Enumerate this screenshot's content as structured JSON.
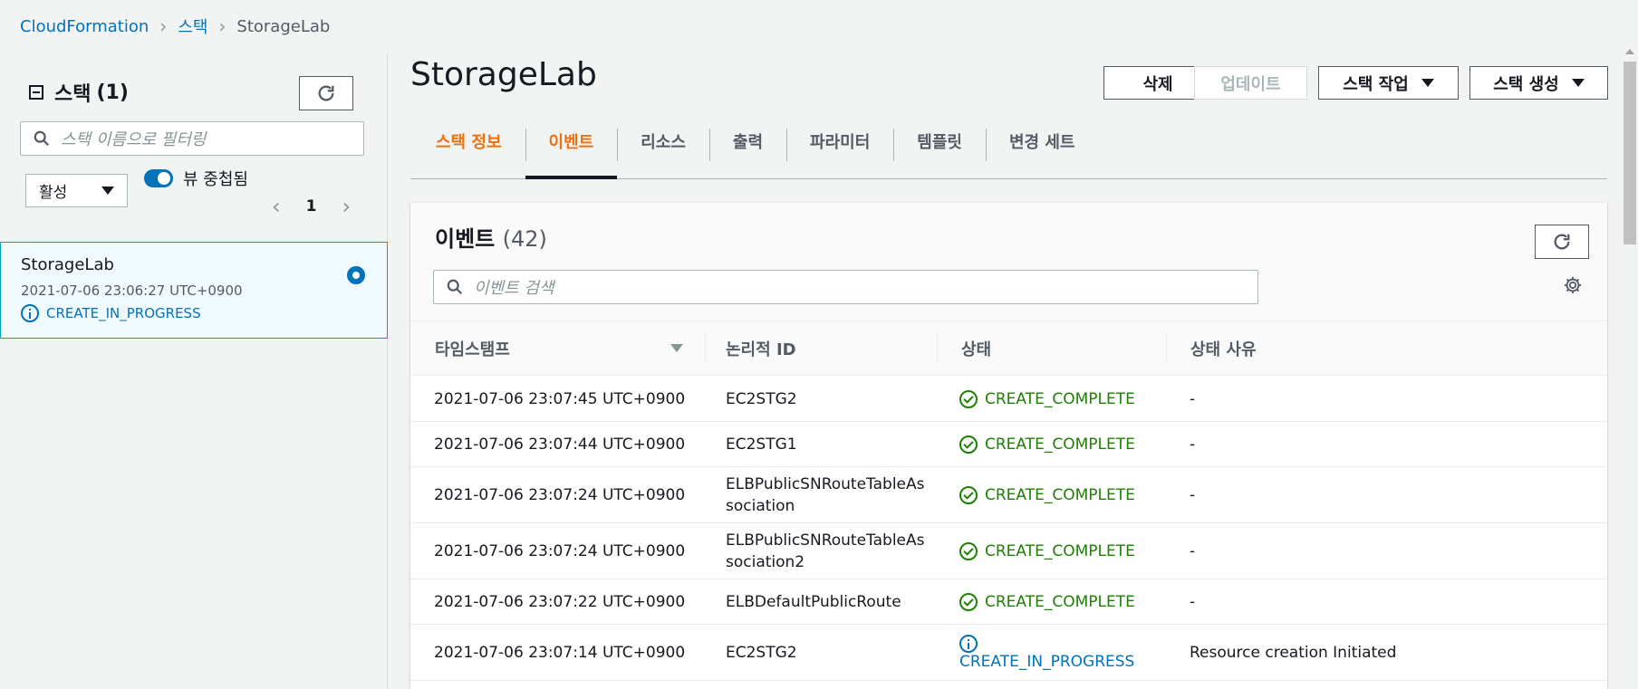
{
  "breadcrumb": {
    "items": [
      "CloudFormation",
      "스택",
      "StorageLab"
    ]
  },
  "sidebar": {
    "title": "스택",
    "count": "(1)",
    "search_placeholder": "스택 이름으로 필터링",
    "filter_value": "활성",
    "toggle_label": "뷰 중첩됨",
    "page": "1",
    "stack": {
      "name": "StorageLab",
      "time": "2021-07-06 23:06:27 UTC+0900",
      "status": "CREATE_IN_PROGRESS"
    }
  },
  "main": {
    "title": "StorageLab",
    "buttons": {
      "delete": "삭제",
      "update": "업데이트",
      "stack_actions": "스택 작업",
      "create_stack": "스택 생성"
    },
    "tabs": [
      "스택 정보",
      "이벤트",
      "리소스",
      "출력",
      "파라미터",
      "템플릿",
      "변경 세트"
    ]
  },
  "events": {
    "title": "이벤트",
    "count": "(42)",
    "search_placeholder": "이벤트 검색",
    "columns": [
      "타임스탬프",
      "논리적 ID",
      "상태",
      "상태 사유"
    ],
    "rows": [
      {
        "time": "2021-07-06 23:07:45 UTC+0900",
        "id": "EC2STG2",
        "status": "CREATE_COMPLETE",
        "reason": "-"
      },
      {
        "time": "2021-07-06 23:07:44 UTC+0900",
        "id": "EC2STG1",
        "status": "CREATE_COMPLETE",
        "reason": "-"
      },
      {
        "time": "2021-07-06 23:07:24 UTC+0900",
        "id": "ELBPublicSNRouteTableAssociation",
        "status": "CREATE_COMPLETE",
        "reason": "-"
      },
      {
        "time": "2021-07-06 23:07:24 UTC+0900",
        "id": "ELBPublicSNRouteTableAssociation2",
        "status": "CREATE_COMPLETE",
        "reason": "-"
      },
      {
        "time": "2021-07-06 23:07:22 UTC+0900",
        "id": "ELBDefaultPublicRoute",
        "status": "CREATE_COMPLETE",
        "reason": "-"
      },
      {
        "time": "2021-07-06 23:07:14 UTC+0900",
        "id": "EC2STG2",
        "status": "CREATE_IN_PROGRESS",
        "reason": "Resource creation Initiated"
      }
    ]
  },
  "colors": {
    "link": "#0073bb",
    "accent": "#ec7211",
    "success": "#1d8102"
  }
}
